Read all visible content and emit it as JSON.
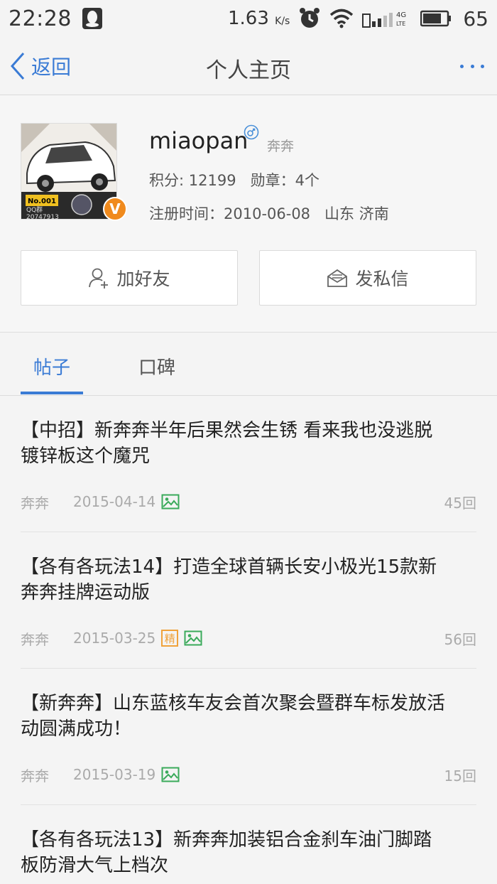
{
  "statusbar": {
    "time": "22:28",
    "speed": "1.63",
    "speed_unit": "K/s",
    "network": "4G LTE",
    "battery": "65"
  },
  "nav": {
    "back_label": "返回",
    "title": "个人主页"
  },
  "profile": {
    "avatar_text": "No.001",
    "avatar_qq_label": "QQ群",
    "avatar_qq_number": "20747913",
    "verify_badge": "V",
    "username": "miaopan",
    "tag": "奔奔",
    "points_label": "积分:",
    "points": "12199",
    "medals_label": "勋章：",
    "medals": "4个",
    "reg_label": "注册时间：",
    "reg_date": "2010-06-08",
    "location": "山东 济南",
    "add_friend_label": "加好友",
    "message_label": "发私信"
  },
  "tabs": {
    "posts": "帖子",
    "reviews": "口碑"
  },
  "posts": [
    {
      "title": "【中招】新奔奔半年后果然会生锈 看来我也没逃脱镀锌板这个魔咒",
      "author": "奔奔",
      "date": "2015-04-14",
      "elite": "",
      "has_image": true,
      "replies": "45回"
    },
    {
      "title": "【各有各玩法14】打造全球首辆长安小极光15款新奔奔挂牌运动版",
      "author": "奔奔",
      "date": "2015-03-25",
      "elite": "精",
      "has_image": true,
      "replies": "56回"
    },
    {
      "title": "【新奔奔】山东蓝核车友会首次聚会暨群车标发放活动圆满成功！",
      "author": "奔奔",
      "date": "2015-03-19",
      "elite": "",
      "has_image": true,
      "replies": "15回"
    },
    {
      "title": "【各有各玩法13】新奔奔加装铝合金刹车油门脚踏板防滑大气上档次",
      "author": "",
      "date": "",
      "elite": "",
      "has_image": false,
      "replies": ""
    }
  ],
  "colors": {
    "accent": "#3a7bd5",
    "badge_orange": "#f08a1d",
    "elite_orange": "#f0a23a",
    "image_icon_green": "#3aaa5a"
  },
  "icons": [
    "qq-icon",
    "alarm-icon",
    "wifi-icon",
    "signal-icon",
    "battery-icon",
    "back-chevron-icon",
    "more-icon",
    "male-gender-icon",
    "add-user-icon",
    "envelope-icon",
    "image-icon"
  ]
}
